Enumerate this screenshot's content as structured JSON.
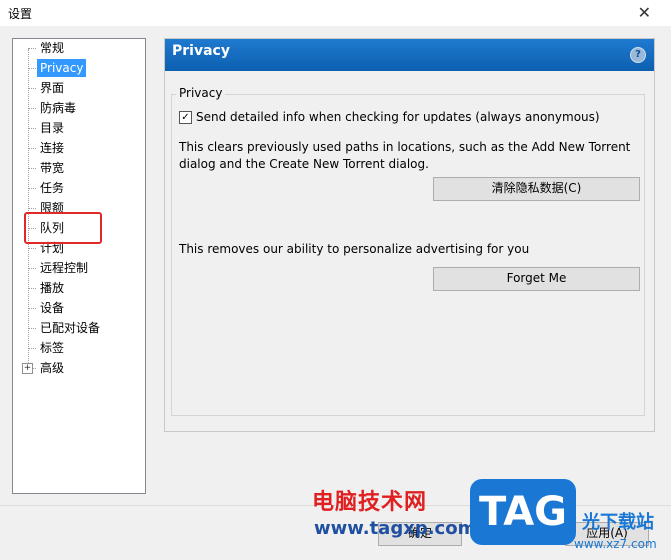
{
  "window": {
    "title": "设置",
    "close_glyph": "✕"
  },
  "tree": {
    "items": [
      {
        "label": "常规"
      },
      {
        "label": "Privacy"
      },
      {
        "label": "界面"
      },
      {
        "label": "防病毒"
      },
      {
        "label": "目录"
      },
      {
        "label": "连接"
      },
      {
        "label": "带宽"
      },
      {
        "label": "任务"
      },
      {
        "label": "限额"
      },
      {
        "label": "队列"
      },
      {
        "label": "计划"
      },
      {
        "label": "远程控制"
      },
      {
        "label": "播放"
      },
      {
        "label": "设备"
      },
      {
        "label": "已配对设备"
      },
      {
        "label": "标签"
      },
      {
        "label": "高级"
      }
    ],
    "selected": "Privacy",
    "highlighted": "队列",
    "expander_glyph": "+"
  },
  "panel": {
    "header_title": "Privacy",
    "help_glyph": "?",
    "group_label": "Privacy",
    "send_info_checkbox": {
      "checked": true,
      "glyph": "✓",
      "label": "Send detailed info when checking for updates (always anonymous)"
    },
    "clear_desc_line1": "This clears previously used paths in locations, such as the Add New Torrent",
    "clear_desc_line2": "dialog and the Create New Torrent dialog.",
    "clear_button": "清除隐私数据(C)",
    "personalize_desc": "This removes our ability to personalize advertising for you",
    "forget_button": "Forget Me"
  },
  "footer": {
    "ok_partial": "确定",
    "apply_partial": "应用(A)"
  },
  "watermark": {
    "line1": "电脑技术网",
    "line2": "www.tagxp.com",
    "badge": "TAG",
    "site_cn": "光下载站",
    "site_url": "www.xz7.com"
  }
}
